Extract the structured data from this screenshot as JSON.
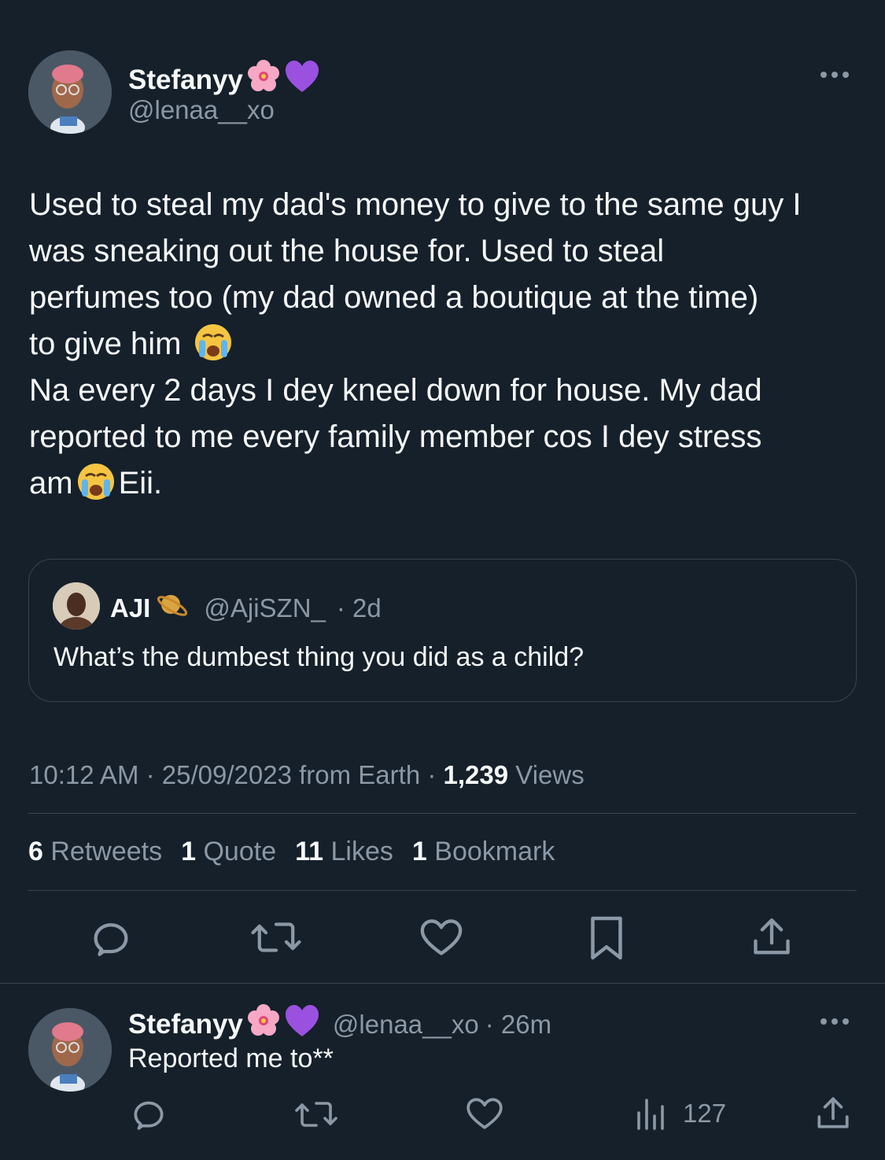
{
  "tweet": {
    "author": {
      "name": "Stefanyy",
      "handle": "@lenaa__xo",
      "name_emojis": [
        "cherry-blossom",
        "purple-heart"
      ]
    },
    "text_lines": [
      "Used to steal my dad's money to give to the same guy I",
      "was sneaking out the house for. Used to steal",
      "perfumes too (my dad owned a boutique at the time)",
      "to give him",
      "Na every 2 days I dey kneel down for house. My dad",
      "reported to me every family member cos I dey stress",
      "am",
      "Eii."
    ],
    "quoted": {
      "name": "AJI",
      "handle": "@AjiSZN_",
      "age": "· 2d",
      "text": "What’s the dumbest thing you did as a child?"
    },
    "meta": {
      "time": "10:12 AM",
      "sep1": "·",
      "date": "25/09/2023",
      "source": "from Earth",
      "sep2": "·",
      "views": "1,239",
      "views_label": "Views"
    },
    "stats": [
      {
        "count": "6",
        "label": "Retweets"
      },
      {
        "count": "1",
        "label": "Quote"
      },
      {
        "count": "11",
        "label": "Likes"
      },
      {
        "count": "1",
        "label": "Bookmark"
      }
    ],
    "actions": [
      "reply-icon",
      "retweet-icon",
      "like-icon",
      "bookmark-icon",
      "share-icon"
    ]
  },
  "reply": {
    "author": {
      "name": "Stefanyy",
      "handle": "@lenaa__xo",
      "age": "· 26m"
    },
    "text": "Reported me to**",
    "views": "127",
    "actions": [
      "reply-icon",
      "retweet-icon",
      "like-icon",
      "views-icon",
      "share-icon"
    ]
  },
  "colors": {
    "background": "#15202b",
    "text": "#f7f9f9",
    "secondary": "#8b98a5",
    "border": "#38444d"
  }
}
